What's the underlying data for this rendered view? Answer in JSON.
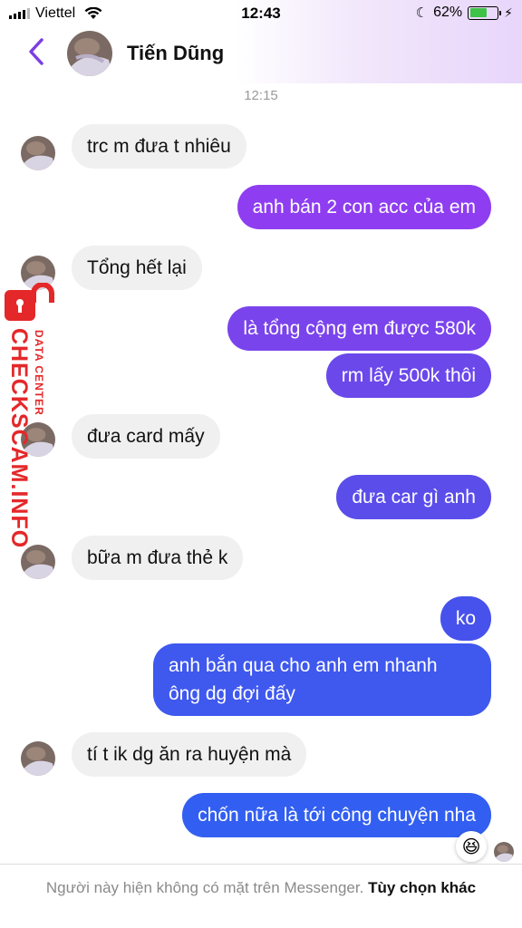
{
  "status_bar": {
    "carrier": "Viettel",
    "time": "12:43",
    "battery_percent": "62%",
    "battery_level": 0.62,
    "battery_color": "#3ec248",
    "icons": [
      "signal-icon",
      "wifi-icon",
      "moon-icon",
      "battery-icon",
      "charging-icon"
    ]
  },
  "header": {
    "contact_name": "Tiến Dũng",
    "back_icon": "chevron-left-icon",
    "accent_color": "#7b3fe4"
  },
  "conversation": {
    "timestamp": "12:15",
    "messages": [
      {
        "dir": "in",
        "text": "trc m đưa t nhiêu"
      },
      {
        "dir": "out",
        "text": "anh bán 2 con acc của em"
      },
      {
        "dir": "in",
        "text": "Tổng hết lại"
      },
      {
        "dir": "out",
        "text": "là tổng cộng em được 580k"
      },
      {
        "dir": "out",
        "text": "rm lấy 500k thôi"
      },
      {
        "dir": "in",
        "text": "đưa card mấy"
      },
      {
        "dir": "out",
        "text": "đưa car gì anh"
      },
      {
        "dir": "in",
        "text": "bữa m đưa thẻ k"
      },
      {
        "dir": "out",
        "text": "ko"
      },
      {
        "dir": "out",
        "text": "anh bắn qua cho anh em nhanh",
        "text2": "ông dg đợi đấy"
      },
      {
        "dir": "in",
        "text": "tí t ik dg ăn ra huyện mà"
      },
      {
        "dir": "out",
        "text": "chốn nữa là tới công chuyện nha"
      }
    ],
    "reaction": "😆"
  },
  "watermark": {
    "main": "CHECKSCAM.INFO",
    "sub": "DATA CENTER"
  },
  "footer": {
    "notice": "Người này hiện không có mặt trên Messenger.",
    "link": "Tùy chọn khác"
  },
  "colors": {
    "incoming_bubble": "#f0f0f0",
    "outgoing_gradient_top": "#8a3ef0",
    "outgoing_gradient_bottom": "#2e63f2",
    "watermark": "#e4282a"
  }
}
